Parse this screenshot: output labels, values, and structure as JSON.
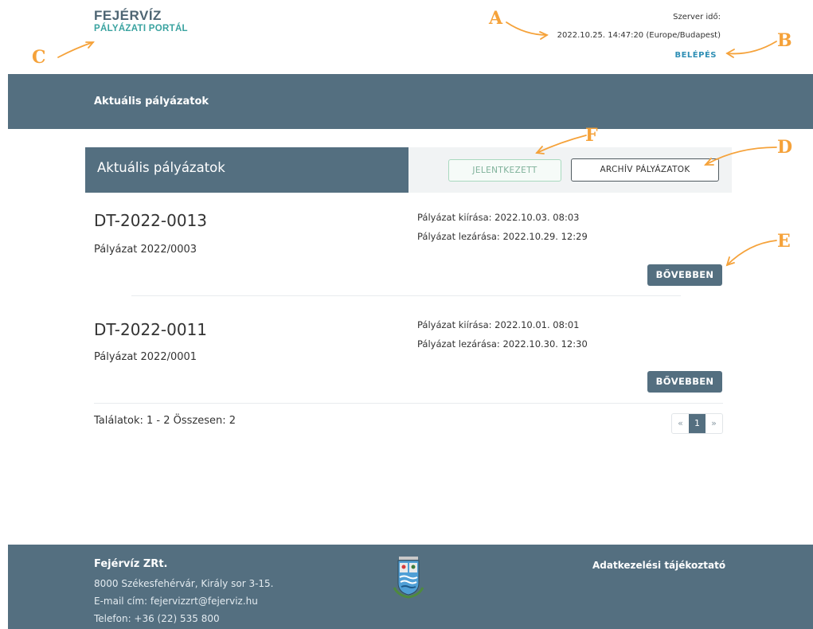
{
  "header": {
    "logo_main": "FEJÉRVÍZ",
    "logo_sub": "PÁLYÁZATI PORTÁL",
    "server_time_label": "Szerver idő:",
    "server_time_value": "2022.10.25. 14:47:20 (Europe/Budapest)",
    "login_label": "BELÉPÉS"
  },
  "topbar": {
    "title": "Aktuális pályázatok"
  },
  "section": {
    "title": "Aktuális pályázatok",
    "reported_label": "JELENTKEZETT",
    "archive_label": "ARCHÍV PÁLYÁZATOK"
  },
  "items": [
    {
      "code": "DT-2022-0013",
      "name": "Pályázat 2022/0003",
      "opened": "Pályázat kiírása: 2022.10.03. 08:03",
      "closes": "Pályázat lezárása: 2022.10.29. 12:29",
      "more_label": "BŐVEBBEN"
    },
    {
      "code": "DT-2022-0011",
      "name": "Pályázat 2022/0001",
      "opened": "Pályázat kiírása: 2022.10.01. 08:01",
      "closes": "Pályázat lezárása: 2022.10.30. 12:30",
      "more_label": "BŐVEBBEN"
    }
  ],
  "results": {
    "text": "Találatok: 1 - 2 Összesen: 2"
  },
  "pagination": {
    "prev": "«",
    "current": "1",
    "next": "»"
  },
  "footer": {
    "company": "Fejérvíz ZRt.",
    "address": "8000 Székesfehérvár, Király sor 3-15.",
    "email": "E-mail cím: fejervizzrt@fejerviz.hu",
    "phone": "Telefon: +36 (22) 535 800",
    "privacy_label": "Adatkezelési tájékoztató",
    "crest_icon": "coat-of-arms-icon"
  },
  "annotations": {
    "a": "A",
    "b": "B",
    "c": "C",
    "d": "D",
    "e": "E",
    "f": "F"
  },
  "colors": {
    "brand_slate": "#546f80",
    "accent_teal": "#3aa3a0",
    "link_blue": "#2f8fb5",
    "annotation_orange": "#f5a23a"
  }
}
